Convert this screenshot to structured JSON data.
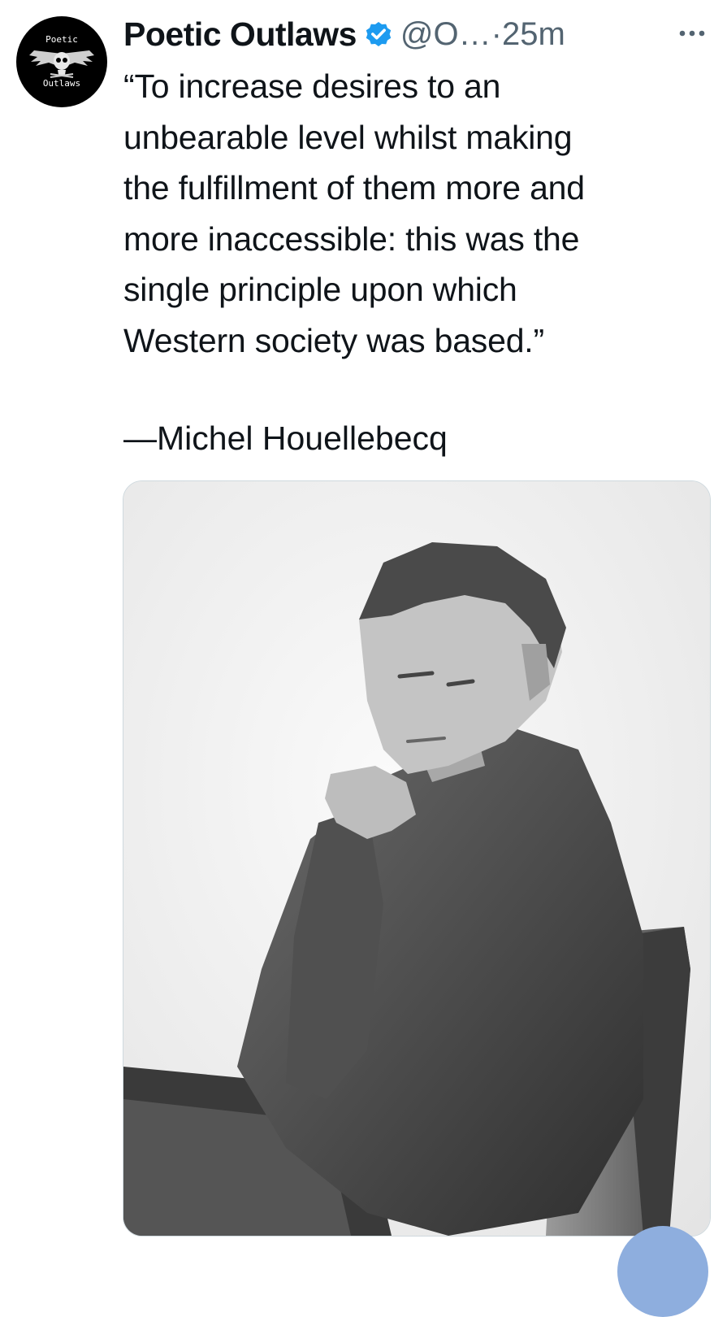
{
  "author": {
    "display_name": "Poetic Outlaws",
    "handle": "@O…",
    "separator": "·",
    "timestamp": "25m",
    "verified": true,
    "avatar_text_top": "Poetic",
    "avatar_text_bottom": "Outlaws",
    "verified_icon": "verified-badge-icon"
  },
  "more_label": "···",
  "tweet": {
    "text": "“To increase desires to an\nunbearable level whilst making\nthe fulfillment of them more and\nmore inaccessible: this was the\nsingle principle upon which\nWestern society was based.”",
    "attribution": "—Michel Houellebecq"
  },
  "colors": {
    "text_primary": "#0f1419",
    "text_secondary": "#536471",
    "verified_blue": "#1d9bf0",
    "border": "#cfd9de",
    "fab": "#8eaede"
  }
}
